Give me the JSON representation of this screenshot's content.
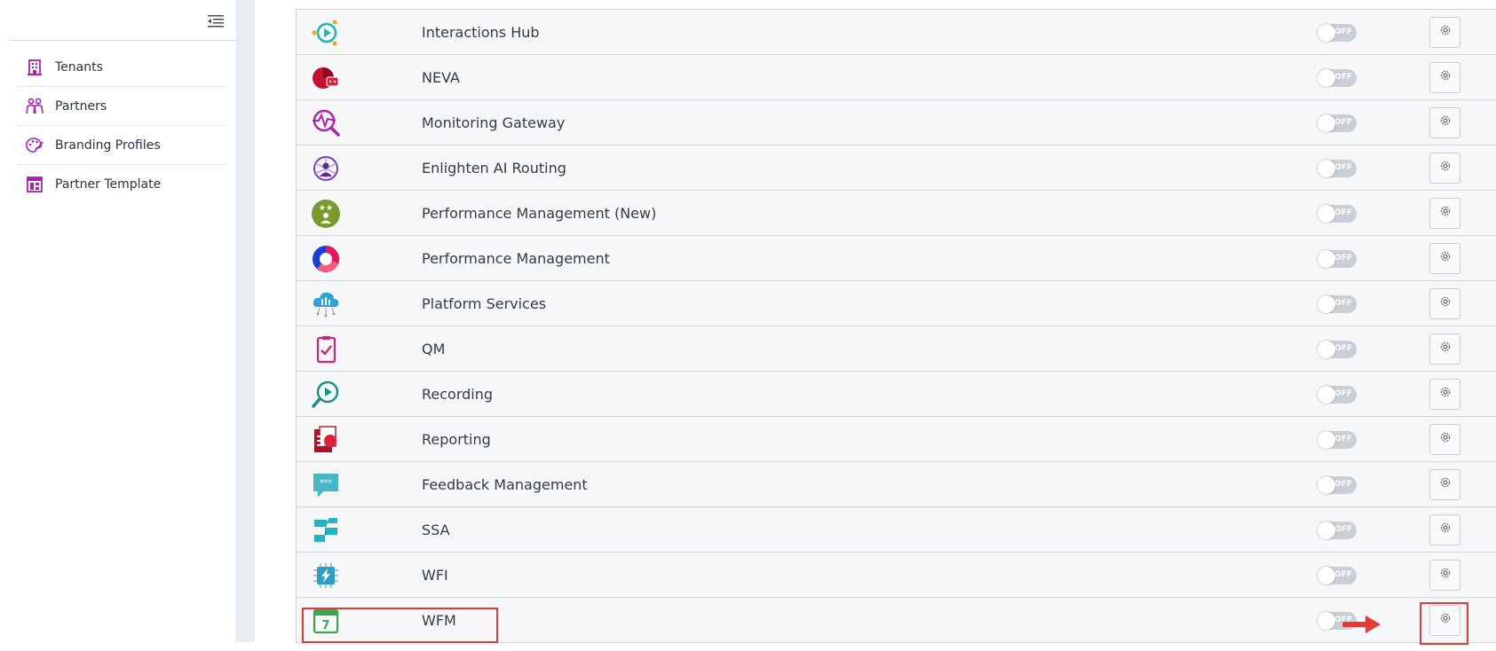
{
  "sidebar": {
    "collapse_icon": "collapse-menu-icon",
    "items": [
      {
        "label": "Tenants",
        "icon": "building-icon"
      },
      {
        "label": "Partners",
        "icon": "partners-icon"
      },
      {
        "label": "Branding Profiles",
        "icon": "palette-icon"
      },
      {
        "label": "Partner Template",
        "icon": "template-icon"
      }
    ]
  },
  "apps": [
    {
      "name": "Interactions Hub",
      "icon": "interactions-hub-icon",
      "toggle": "OFF"
    },
    {
      "name": "NEVA",
      "icon": "neva-icon",
      "toggle": "OFF"
    },
    {
      "name": "Monitoring Gateway",
      "icon": "monitoring-gateway-icon",
      "toggle": "OFF"
    },
    {
      "name": "Enlighten AI Routing",
      "icon": "enlighten-ai-routing-icon",
      "toggle": "OFF"
    },
    {
      "name": "Performance Management (New)",
      "icon": "performance-management-new-icon",
      "toggle": "OFF"
    },
    {
      "name": "Performance Management",
      "icon": "performance-management-icon",
      "toggle": "OFF"
    },
    {
      "name": "Platform Services",
      "icon": "platform-services-icon",
      "toggle": "OFF"
    },
    {
      "name": "QM",
      "icon": "qm-icon",
      "toggle": "OFF"
    },
    {
      "name": "Recording",
      "icon": "recording-icon",
      "toggle": "OFF"
    },
    {
      "name": "Reporting",
      "icon": "reporting-icon",
      "toggle": "OFF"
    },
    {
      "name": "Feedback Management",
      "icon": "feedback-management-icon",
      "toggle": "OFF"
    },
    {
      "name": "SSA",
      "icon": "ssa-icon",
      "toggle": "OFF"
    },
    {
      "name": "WFI",
      "icon": "wfi-icon",
      "toggle": "OFF"
    },
    {
      "name": "WFM",
      "icon": "wfm-calendar-icon",
      "toggle": "OFF",
      "calendar_day": "7"
    }
  ],
  "colors": {
    "accent_purple": "#b01fb5",
    "highlight_red": "#e53935",
    "toggle_off": "#c9cfd6"
  }
}
